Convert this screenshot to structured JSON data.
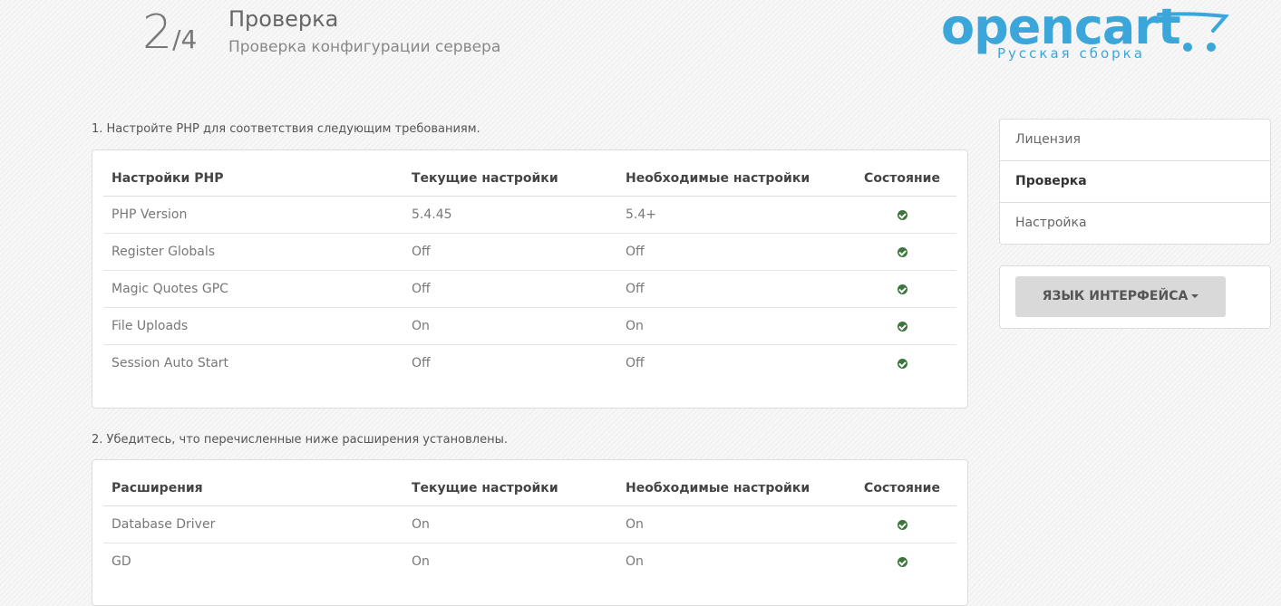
{
  "header": {
    "step_current": "2",
    "step_total": "/4",
    "title": "Проверка",
    "subtitle": "Проверка конфигурации сервера",
    "logo_text": "opencart",
    "logo_sub": "Русская сборка"
  },
  "section1": {
    "label": "1. Настройте PHP для соответствия следующим требованиям.",
    "headers": [
      "Настройки PHP",
      "Текущие настройки",
      "Необходимые настройки",
      "Состояние"
    ],
    "rows": [
      {
        "name": "PHP Version",
        "current": "5.4.45",
        "required": "5.4+",
        "status": "ok"
      },
      {
        "name": "Register Globals",
        "current": "Off",
        "required": "Off",
        "status": "ok"
      },
      {
        "name": "Magic Quotes GPC",
        "current": "Off",
        "required": "Off",
        "status": "ok"
      },
      {
        "name": "File Uploads",
        "current": "On",
        "required": "On",
        "status": "ok"
      },
      {
        "name": "Session Auto Start",
        "current": "Off",
        "required": "Off",
        "status": "ok"
      }
    ]
  },
  "section2": {
    "label": "2. Убедитесь, что перечисленные ниже расширения установлены.",
    "headers": [
      "Расширения",
      "Текущие настройки",
      "Необходимые настройки",
      "Состояние"
    ],
    "rows": [
      {
        "name": "Database Driver",
        "current": "On",
        "required": "On",
        "status": "ok"
      },
      {
        "name": "GD",
        "current": "On",
        "required": "On",
        "status": "ok"
      }
    ]
  },
  "sidebar": {
    "items": [
      {
        "label": "Лицензия",
        "active": false
      },
      {
        "label": "Проверка",
        "active": true
      },
      {
        "label": "Настройка",
        "active": false
      }
    ],
    "language_button": "ЯЗЫК ИНТЕРФЕЙСА"
  },
  "colors": {
    "accent": "#3aa6da",
    "ok": "#3c763d"
  }
}
